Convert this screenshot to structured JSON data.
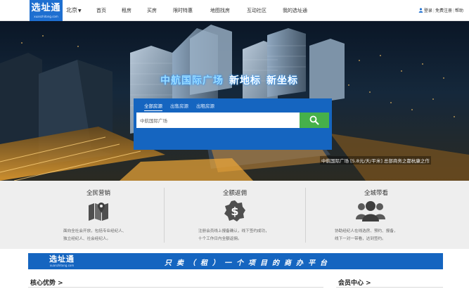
{
  "header": {
    "logo_cn": "选址通",
    "logo_en": "xuanzhitong.com",
    "city": "北京",
    "nav": [
      "首页",
      "租房",
      "买房",
      "限时特惠",
      "地图找房",
      "互动社区",
      "我的选址通"
    ],
    "login": "登录",
    "register": "免费注册",
    "help": "帮助"
  },
  "hero": {
    "title_1": "中航国际广场",
    "title_2": "新地标",
    "title_3": "新坐标",
    "caption": "中航国际广场 [5.8元/天/平米] 总部商务之都杭康之作"
  },
  "search": {
    "tabs": [
      "全部房源",
      "出售房源",
      "出租房源"
    ],
    "value": "中航国际广场"
  },
  "features": [
    {
      "title": "全民营销",
      "icon": "map-icon",
      "desc": [
        "面向全社会开放，包括专业经纪人、",
        "独立经纪人、社会经纪人。"
      ]
    },
    {
      "title": "全额返佣",
      "icon": "dollar-badge-icon",
      "desc": [
        "注册会员线上报备确认，线下签约成功，",
        "十个工作日内全额返佣。"
      ]
    },
    {
      "title": "全城带看",
      "icon": "group-icon",
      "desc": [
        "协助经纪人在线选房、预约、报备，",
        "线下一对一带看，达到签约。"
      ]
    }
  ],
  "banner": {
    "logo_cn": "选址通",
    "logo_en": "xuanzhitong.com",
    "text": "只卖（租）一个项目的商办平台"
  },
  "sections": {
    "core": "核心优势 >",
    "member": "会员中心 >"
  },
  "colors": {
    "brand_blue": "#1565c0",
    "search_green": "#46b04a",
    "feature_bg": "#eeeeee",
    "icon_gray": "#4f4f4f"
  }
}
